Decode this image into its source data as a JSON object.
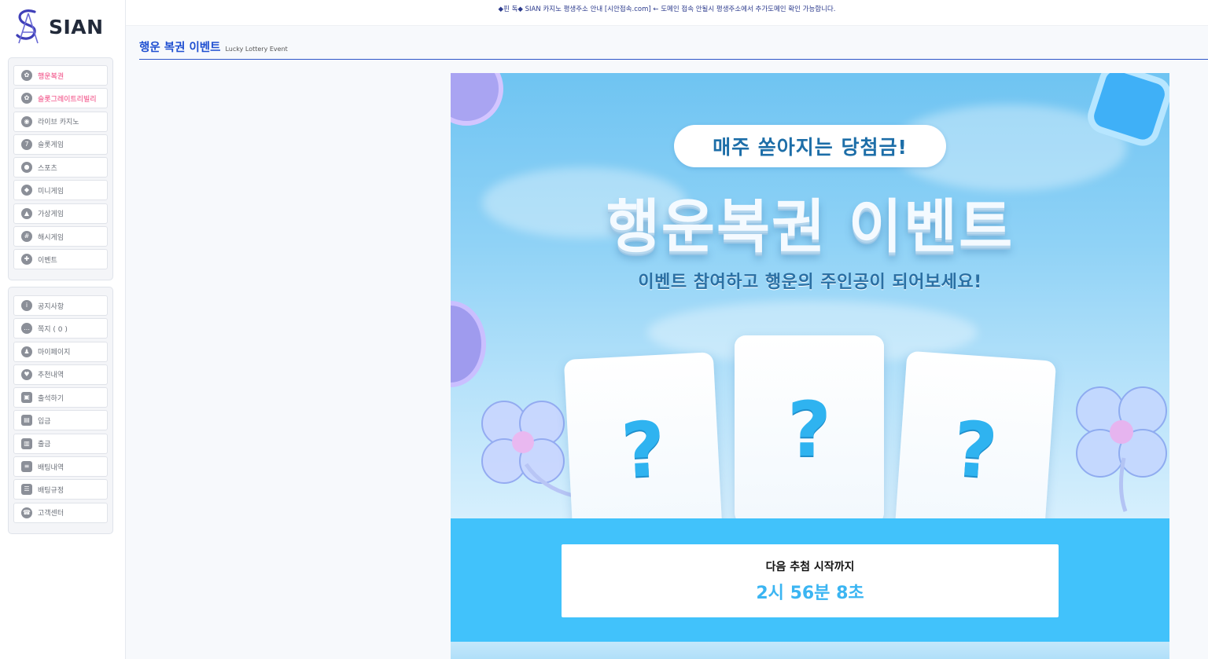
{
  "notice": {
    "text": "◆핀 독◆ SIAN 카지노 평생주소 안내 [시안접속.com] ← 도메인 접속 안될시 평생주소에서 추가도메인 확인 가능합니다."
  },
  "logo": {
    "text": "SIAN"
  },
  "sidebar": {
    "group1": [
      {
        "label": "행운복권",
        "icon": "clover-icon",
        "hot": true
      },
      {
        "label": "슬롯그레이트리빌리",
        "icon": "clover-icon",
        "hot": true
      },
      {
        "label": "라이브 카지노",
        "icon": "chip-icon"
      },
      {
        "label": "슬롯게임",
        "icon": "slot-icon"
      },
      {
        "label": "스포츠",
        "icon": "soccer-icon"
      },
      {
        "label": "미니게임",
        "icon": "mini-game-icon"
      },
      {
        "label": "가상게임",
        "icon": "virtual-game-icon"
      },
      {
        "label": "해시게임",
        "icon": "hash-game-icon"
      },
      {
        "label": "이벤트",
        "icon": "gift-icon"
      }
    ],
    "group2": [
      {
        "label": "공지사항",
        "icon": "info-icon"
      },
      {
        "label": "쪽지 ( 0 )",
        "icon": "message-icon"
      },
      {
        "label": "마이페이지",
        "icon": "user-icon"
      },
      {
        "label": "추천내역",
        "icon": "heart-icon"
      },
      {
        "label": "출석하기",
        "icon": "calendar-icon"
      },
      {
        "label": "입금",
        "icon": "wallet-icon"
      },
      {
        "label": "출금",
        "icon": "wallet-out-icon"
      },
      {
        "label": "배팅내역",
        "icon": "document-icon"
      },
      {
        "label": "배팅규정",
        "icon": "rules-icon"
      },
      {
        "label": "고객센터",
        "icon": "support-icon"
      }
    ]
  },
  "page": {
    "title": "행운 복권 이벤트",
    "subtitle": "Lucky Lottery Event"
  },
  "banner": {
    "pill": "매주 쏟아지는 당첨금!",
    "headline": "행운복권 이벤트",
    "subline": "이벤트 참여하고 행운의 주인공이 되어보세요!",
    "cards": [
      "?",
      "?",
      "?"
    ]
  },
  "countdown": {
    "label": "다음 추첨 시작까지",
    "time": "2시 56분 8초"
  },
  "colors": {
    "accent": "#1f4fd1",
    "countdown_bg": "#41c2fb",
    "countdown_text": "#3bb5f2",
    "hot_menu": "#f05a8c"
  }
}
